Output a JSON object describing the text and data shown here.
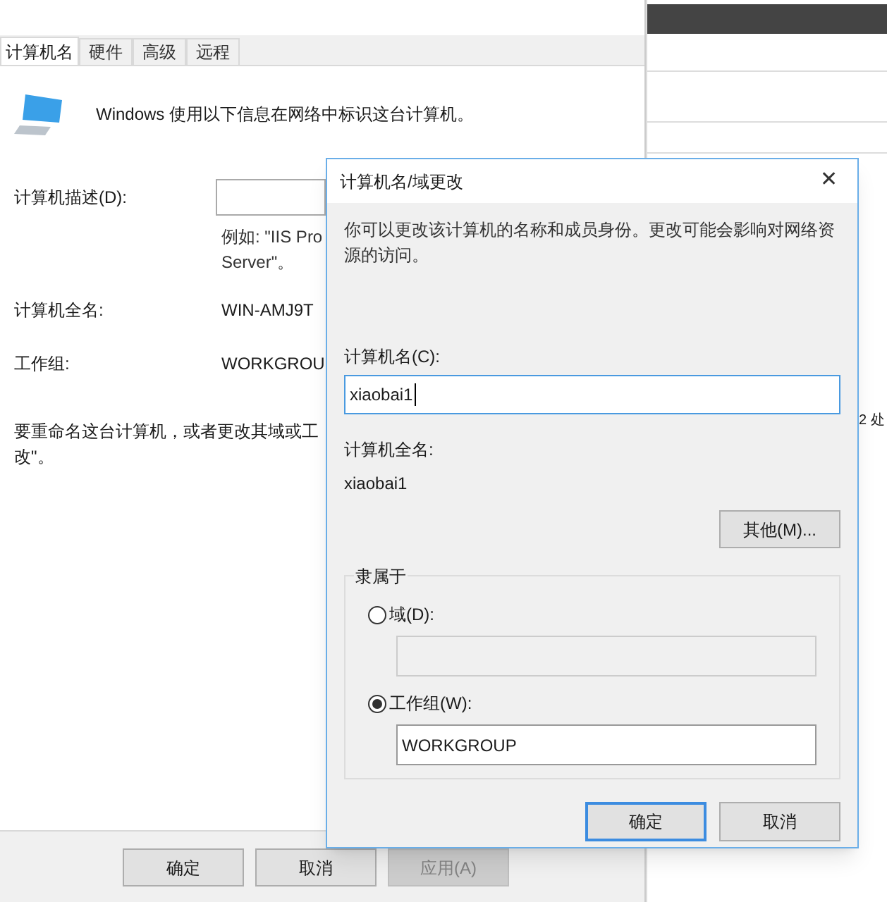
{
  "back_window": {
    "tabs": [
      {
        "label": "计算机名",
        "selected": true
      },
      {
        "label": "硬件",
        "selected": false
      },
      {
        "label": "高级",
        "selected": false
      },
      {
        "label": "远程",
        "selected": false
      }
    ],
    "intro": "Windows 使用以下信息在网络中标识这台计算机。",
    "description": {
      "label": "计算机描述(D):",
      "hint": [
        "例如: \"IIS Pro",
        "Server\"。"
      ]
    },
    "fields": [
      {
        "label": "计算机全名:",
        "value": "WIN-AMJ9T"
      },
      {
        "label": "工作组:",
        "value": "WORKGROU"
      }
    ],
    "rename_note": [
      "要重命名这台计算机，或者更改其域或工",
      "改\"。"
    ],
    "rename_note_tail": "2 处",
    "buttons": [
      {
        "label": "确定",
        "disabled": false
      },
      {
        "label": "取消",
        "disabled": false
      },
      {
        "label": "应用(A)",
        "disabled": true
      }
    ]
  },
  "dialog": {
    "title": "计算机名/域更改",
    "close": "✕",
    "description": "你可以更改该计算机的名称和成员身份。更改可能会影响对网络资源的访问。",
    "computer_name": {
      "label": "计算机名(C):",
      "value": "xiaobai1"
    },
    "full_name": {
      "label": "计算机全名:",
      "value": "xiaobai1"
    },
    "more_button": "其他(M)...",
    "member_of": {
      "legend": "隶属于",
      "options": [
        {
          "label": "域(D):",
          "selected": false
        },
        {
          "label": "工作组(W):",
          "selected": true,
          "value": "WORKGROUP"
        }
      ]
    },
    "buttons": [
      {
        "label": "确定",
        "default": true
      },
      {
        "label": "取消",
        "default": false
      }
    ]
  }
}
